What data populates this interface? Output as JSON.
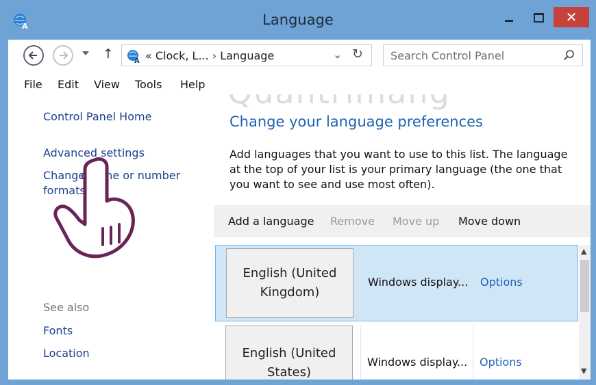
{
  "window": {
    "title": "Language",
    "close_glyph": "✕"
  },
  "nav": {
    "breadcrumb_prefix": "«",
    "breadcrumb_parent": "Clock, L...",
    "breadcrumb_sep": "›",
    "breadcrumb_current": "Language",
    "search_placeholder": "Search Control Panel"
  },
  "menu": {
    "items": [
      "File",
      "Edit",
      "View",
      "Tools",
      "Help"
    ]
  },
  "sidebar": {
    "home": "Control Panel Home",
    "advanced": "Advanced settings",
    "change_formats_a": "Change",
    "change_formats_b": "e, time or number",
    "change_formats_c": "formats",
    "see_also": "See also",
    "fonts": "Fonts",
    "location": "Location"
  },
  "main": {
    "title": "Change your language preferences",
    "description": "Add languages that you want to use to this list. The language at the top of your list is your primary language (the one that you want to see and use most often).",
    "toolbar": {
      "add": "Add a language",
      "remove": "Remove",
      "move_up": "Move up",
      "move_down": "Move down"
    },
    "languages": [
      {
        "name": "English (United Kingdom)",
        "status": "Windows display...",
        "options": "Options",
        "selected": true
      },
      {
        "name": "English (United States)",
        "status": "Windows display...",
        "options": "Options",
        "selected": false
      }
    ]
  },
  "colors": {
    "titlebar": "#6fa3d6",
    "link": "#1e63b5",
    "close_button": "#c7423a",
    "selection": "#cfe6f6"
  },
  "icons": [
    "language-icon",
    "back-arrow-icon",
    "forward-arrow-icon",
    "up-arrow-icon",
    "refresh-icon",
    "search-icon",
    "pointing-hand-icon"
  ]
}
